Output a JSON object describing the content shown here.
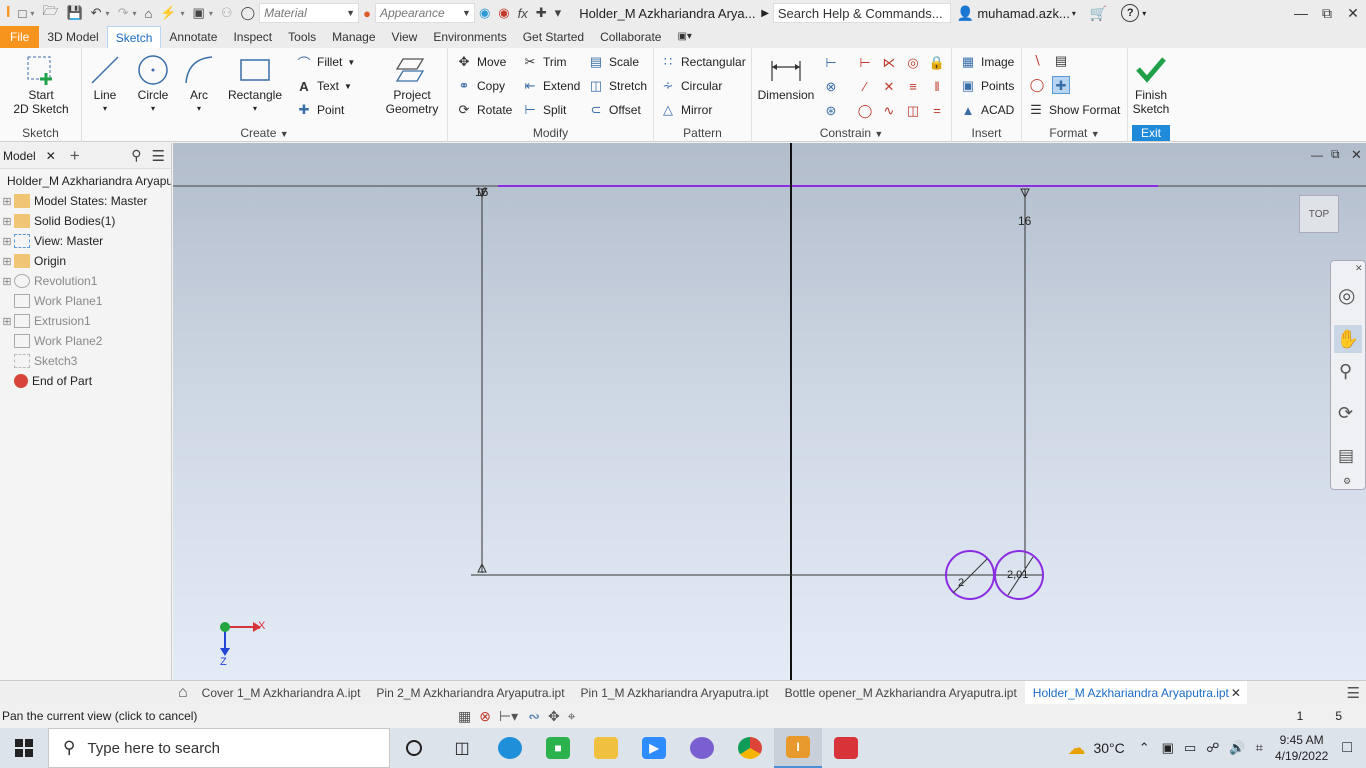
{
  "titlebar": {
    "material_placeholder": "Material",
    "appearance_placeholder": "Appearance",
    "document_title": "Holder_M Azkhariandra Arya...",
    "search_placeholder": "Search Help & Commands...",
    "user": "muhamad.azk...",
    "help_symbol": "?"
  },
  "menu": {
    "file": "File",
    "tabs": [
      "3D Model",
      "Sketch",
      "Annotate",
      "Inspect",
      "Tools",
      "Manage",
      "View",
      "Environments",
      "Get Started",
      "Collaborate"
    ],
    "active": "Sketch"
  },
  "ribbon": {
    "sketch_panel": {
      "title": "Sketch",
      "start_label_1": "Start",
      "start_label_2": "2D Sketch"
    },
    "create_panel": {
      "title": "Create",
      "line": "Line",
      "circle": "Circle",
      "arc": "Arc",
      "rectangle": "Rectangle",
      "fillet": "Fillet",
      "text": "Text",
      "point": "Point",
      "project_1": "Project",
      "project_2": "Geometry"
    },
    "modify_panel": {
      "title": "Modify",
      "move": "Move",
      "copy": "Copy",
      "rotate": "Rotate",
      "trim": "Trim",
      "extend": "Extend",
      "split": "Split",
      "scale": "Scale",
      "stretch": "Stretch",
      "offset": "Offset"
    },
    "pattern_panel": {
      "title": "Pattern",
      "rectangular": "Rectangular",
      "circular": "Circular",
      "mirror": "Mirror"
    },
    "constrain_panel": {
      "title": "Constrain",
      "dimension": "Dimension"
    },
    "insert_panel": {
      "title": "Insert",
      "image": "Image",
      "points": "Points",
      "acad": "ACAD"
    },
    "format_panel": {
      "title": "Format",
      "show_format": "Show Format"
    },
    "exit_panel": {
      "title": "Exit",
      "finish_1": "Finish",
      "finish_2": "Sketch"
    }
  },
  "browser": {
    "tab": "Model",
    "add": "+",
    "items": [
      {
        "label": "Holder_M Azkhariandra Aryaputra.ipt",
        "dim": false
      },
      {
        "label": "Model States: Master",
        "dim": false
      },
      {
        "label": "Solid Bodies(1)",
        "dim": false
      },
      {
        "label": "View: Master",
        "dim": false
      },
      {
        "label": "Origin",
        "dim": false
      },
      {
        "label": "Revolution1",
        "dim": true
      },
      {
        "label": "Work Plane1",
        "dim": true
      },
      {
        "label": "Extrusion1",
        "dim": true
      },
      {
        "label": "Work Plane2",
        "dim": true
      },
      {
        "label": "Sketch3",
        "dim": true
      },
      {
        "label": "End of Part",
        "dim": false
      }
    ]
  },
  "canvas": {
    "viewcube": "TOP",
    "dim_left": "16",
    "dim_right": "16",
    "dia_left": "2",
    "dia_right": "2,01",
    "axis_x": "X",
    "axis_z": "Z"
  },
  "doctabs": [
    "Cover 1_M Azkhariandra A.ipt",
    "Pin 2_M Azkhariandra Aryaputra.ipt",
    "Pin 1_M Azkhariandra Aryaputra.ipt",
    "Bottle opener_M Azkhariandra Aryaputra.ipt",
    "Holder_M Azkhariandra Aryaputra.ipt"
  ],
  "statusbar": {
    "message": "Pan the current view (click to cancel)",
    "count_1": "1",
    "count_2": "5"
  },
  "taskbar": {
    "search_placeholder": "Type here to search",
    "temperature": "30°C",
    "time": "9:45 AM",
    "date": "4/19/2022"
  },
  "colors": {
    "accent": "#1b6cc4",
    "file_tab": "#f7941d",
    "sketch_purple": "#8b2be2",
    "finish_green": "#21a04a"
  }
}
